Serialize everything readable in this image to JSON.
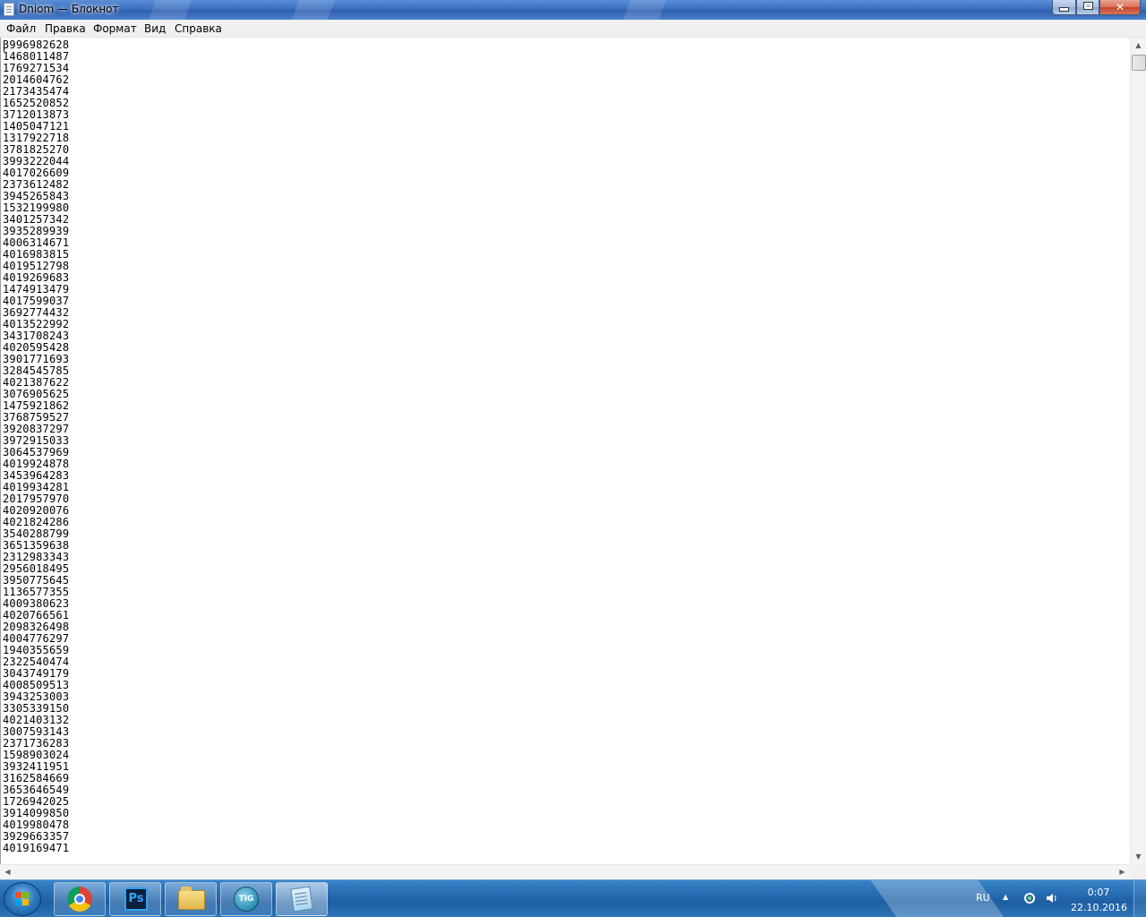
{
  "window": {
    "title": "Dniom — Блокнот",
    "controls": {
      "minimize": "minimize",
      "maximize": "maximize",
      "close": "✕"
    }
  },
  "menu": {
    "items": [
      "Файл",
      "Правка",
      "Формат",
      "Вид",
      "Справка"
    ]
  },
  "document": {
    "lines": [
      "3996982628",
      "1468011487",
      "1769271534",
      "2014604762",
      "2173435474",
      "1652520852",
      "3712013873",
      "1405047121",
      "1317922718",
      "3781825270",
      "3993222044",
      "4017026609",
      "2373612482",
      "3945265843",
      "1532199980",
      "3401257342",
      "3935289939",
      "4006314671",
      "4016983815",
      "4019512798",
      "4019269683",
      "1474913479",
      "4017599037",
      "3692774432",
      "4013522992",
      "3431708243",
      "4020595428",
      "3901771693",
      "3284545785",
      "4021387622",
      "3076905625",
      "1475921862",
      "3768759527",
      "3920837297",
      "3972915033",
      "3064537969",
      "4019924878",
      "3453964283",
      "4019934281",
      "2017957970",
      "4020920076",
      "4021824286",
      "3540288799",
      "3651359638",
      "2312983343",
      "2956018495",
      "3950775645",
      "1136577355",
      "4009380623",
      "4020766561",
      "2098326498",
      "4004776297",
      "1940355659",
      "2322540474",
      "3043749179",
      "4008509513",
      "3943253003",
      "3305339150",
      "4021403132",
      "3007593143",
      "2371736283",
      "1598903024",
      "3932411951",
      "3162584669",
      "3653646549",
      "1726942025",
      "3914099850",
      "4019980478",
      "3929663357",
      "4019169471"
    ]
  },
  "taskbar": {
    "apps": [
      {
        "name": "chrome-icon"
      },
      {
        "name": "photoshop-icon",
        "label": "Ps"
      },
      {
        "name": "folder-icon"
      },
      {
        "name": "tig-cloud-icon",
        "label": "TIG"
      },
      {
        "name": "notepad-icon",
        "active": true
      }
    ],
    "tray": {
      "language": "RU",
      "time": "0:07",
      "date": "22.10.2016"
    }
  },
  "colors": {
    "title_bar": "#3a6fc0",
    "taskbar": "#2a70b6",
    "close_button": "#c5442a",
    "editor_bg": "#ffffff",
    "text": "#000000"
  }
}
